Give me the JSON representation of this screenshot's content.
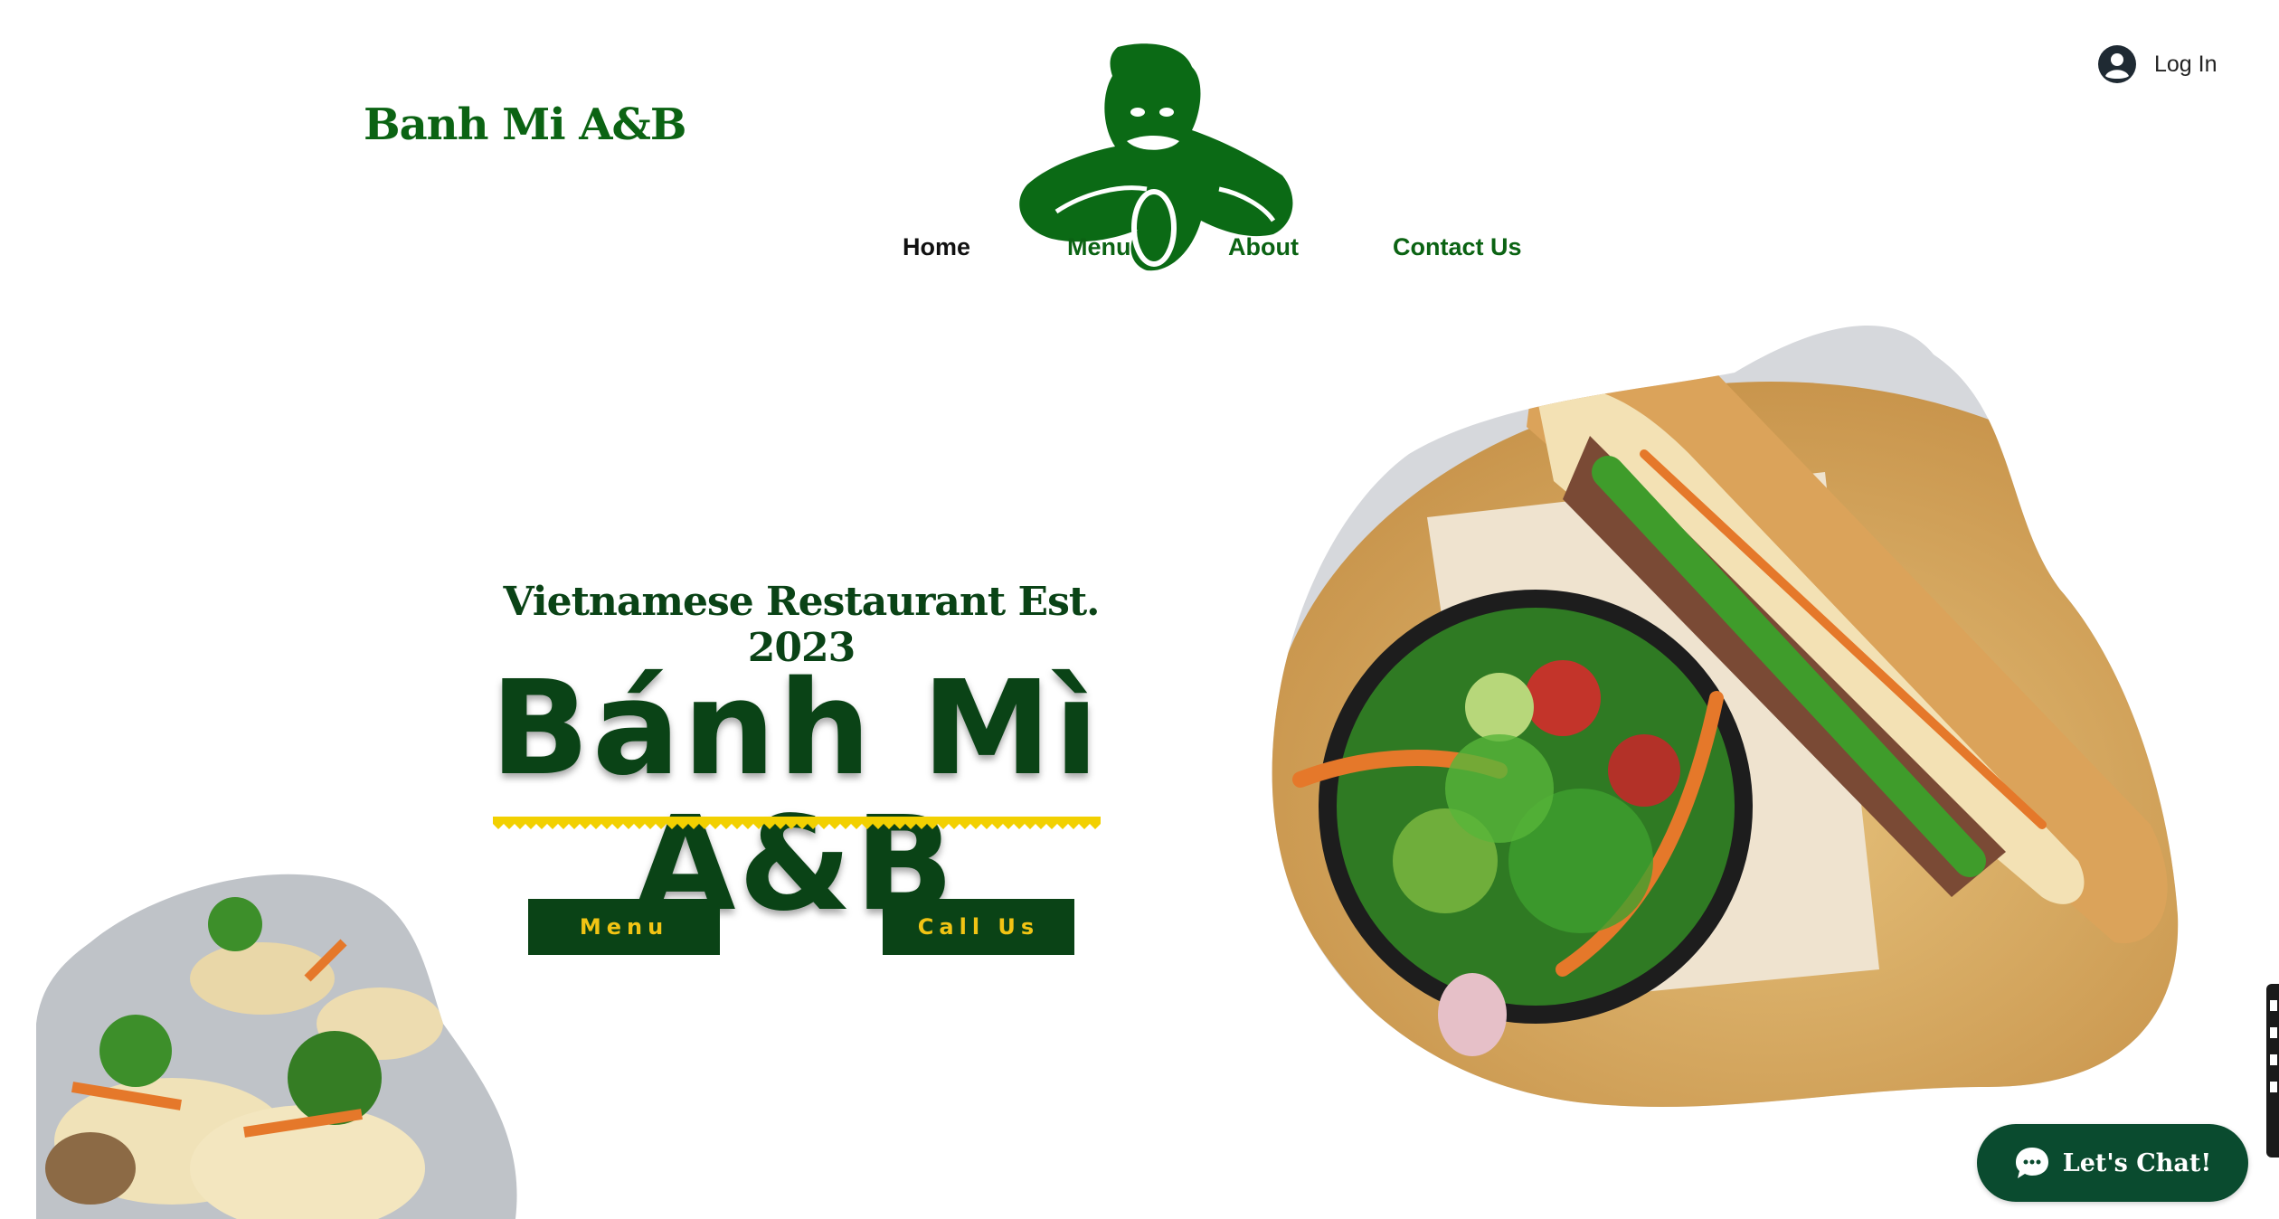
{
  "header": {
    "brand": "Banh Mi A&B",
    "login_label": "Log In"
  },
  "nav": {
    "items": [
      {
        "label": "Home",
        "color": "#111111"
      },
      {
        "label": "Menu",
        "color": "#0b6313"
      },
      {
        "label": "About",
        "color": "#0b6313"
      },
      {
        "label": "Contact Us",
        "color": "#0b6313"
      }
    ]
  },
  "hero": {
    "subtitle": "Vietnamese Restaurant Est. 2023",
    "title": "Bánh Mì A&B",
    "buttons": {
      "menu_label": "Menu",
      "call_label": "Call Us"
    }
  },
  "chat": {
    "label": "Let's Chat!"
  },
  "colors": {
    "brand_green": "#0b6313",
    "dark_green": "#0a4316",
    "button_text": "#f2c414",
    "accent_yellow": "#f2d000",
    "chat_bg": "#0a4b2f"
  },
  "icons": {
    "login": "user-avatar-icon",
    "logo": "gorilla-logo-icon",
    "chat": "chat-bubble-icon"
  }
}
